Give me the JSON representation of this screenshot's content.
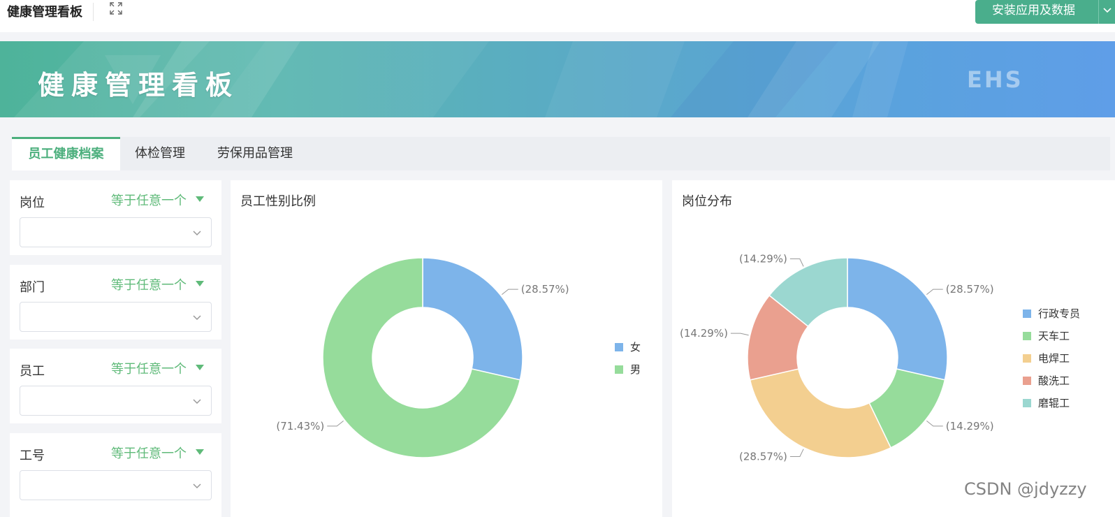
{
  "app": {
    "title": "健康管理看板",
    "install_label": "安装应用及数据"
  },
  "banner": {
    "title": "健康管理看板",
    "logo_text": "EHS"
  },
  "tabs": [
    {
      "label": "员工健康档案",
      "active": true
    },
    {
      "label": "体检管理",
      "active": false
    },
    {
      "label": "劳保用品管理",
      "active": false
    }
  ],
  "filters": [
    {
      "label": "岗位",
      "operator": "等于任意一个",
      "value": ""
    },
    {
      "label": "部门",
      "operator": "等于任意一个",
      "value": ""
    },
    {
      "label": "员工",
      "operator": "等于任意一个",
      "value": ""
    },
    {
      "label": "工号",
      "operator": "等于任意一个",
      "value": ""
    }
  ],
  "colors": {
    "accent": "#4caf7d",
    "blue": "#7db4ea",
    "green": "#96dc9b",
    "yellow": "#f3cf90",
    "red": "#eaa08f",
    "teal": "#9bd7d0"
  },
  "chart_data": [
    {
      "type": "pie",
      "donut": true,
      "title": "员工性别比例",
      "legend_position": "right",
      "series": [
        {
          "name": "女",
          "value": 28.57,
          "label": "(28.57%)",
          "color": "#7db4ea"
        },
        {
          "name": "男",
          "value": 71.43,
          "label": "(71.43%)",
          "color": "#96dc9b"
        }
      ]
    },
    {
      "type": "pie",
      "donut": true,
      "title": "岗位分布",
      "legend_position": "right",
      "series": [
        {
          "name": "行政专员",
          "value": 28.57,
          "label": "(28.57%)",
          "color": "#7db4ea"
        },
        {
          "name": "天车工",
          "value": 14.29,
          "label": "(14.29%)",
          "color": "#96dc9b"
        },
        {
          "name": "电焊工",
          "value": 28.57,
          "label": "(28.57%)",
          "color": "#f3cf90"
        },
        {
          "name": "酸洗工",
          "value": 14.29,
          "label": "(14.29%)",
          "color": "#eaa08f"
        },
        {
          "name": "磨辊工",
          "value": 14.29,
          "label": "(14.29%)",
          "color": "#9bd7d0"
        }
      ]
    }
  ],
  "watermark": "CSDN @jdyzzy"
}
